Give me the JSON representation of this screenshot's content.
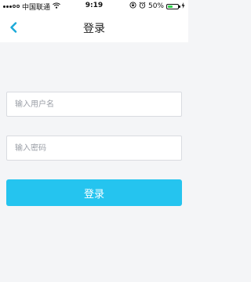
{
  "status_bar": {
    "carrier": "中国联通",
    "time": "9:19",
    "battery_percent": "50%",
    "battery_level": 0.5
  },
  "nav": {
    "title": "登录",
    "accent_color": "#1aa9d8"
  },
  "form": {
    "username_placeholder": "输入用户名",
    "username_value": "",
    "password_placeholder": "输入密码",
    "password_value": "",
    "submit_label": "登录",
    "submit_color": "#25c4ef"
  }
}
